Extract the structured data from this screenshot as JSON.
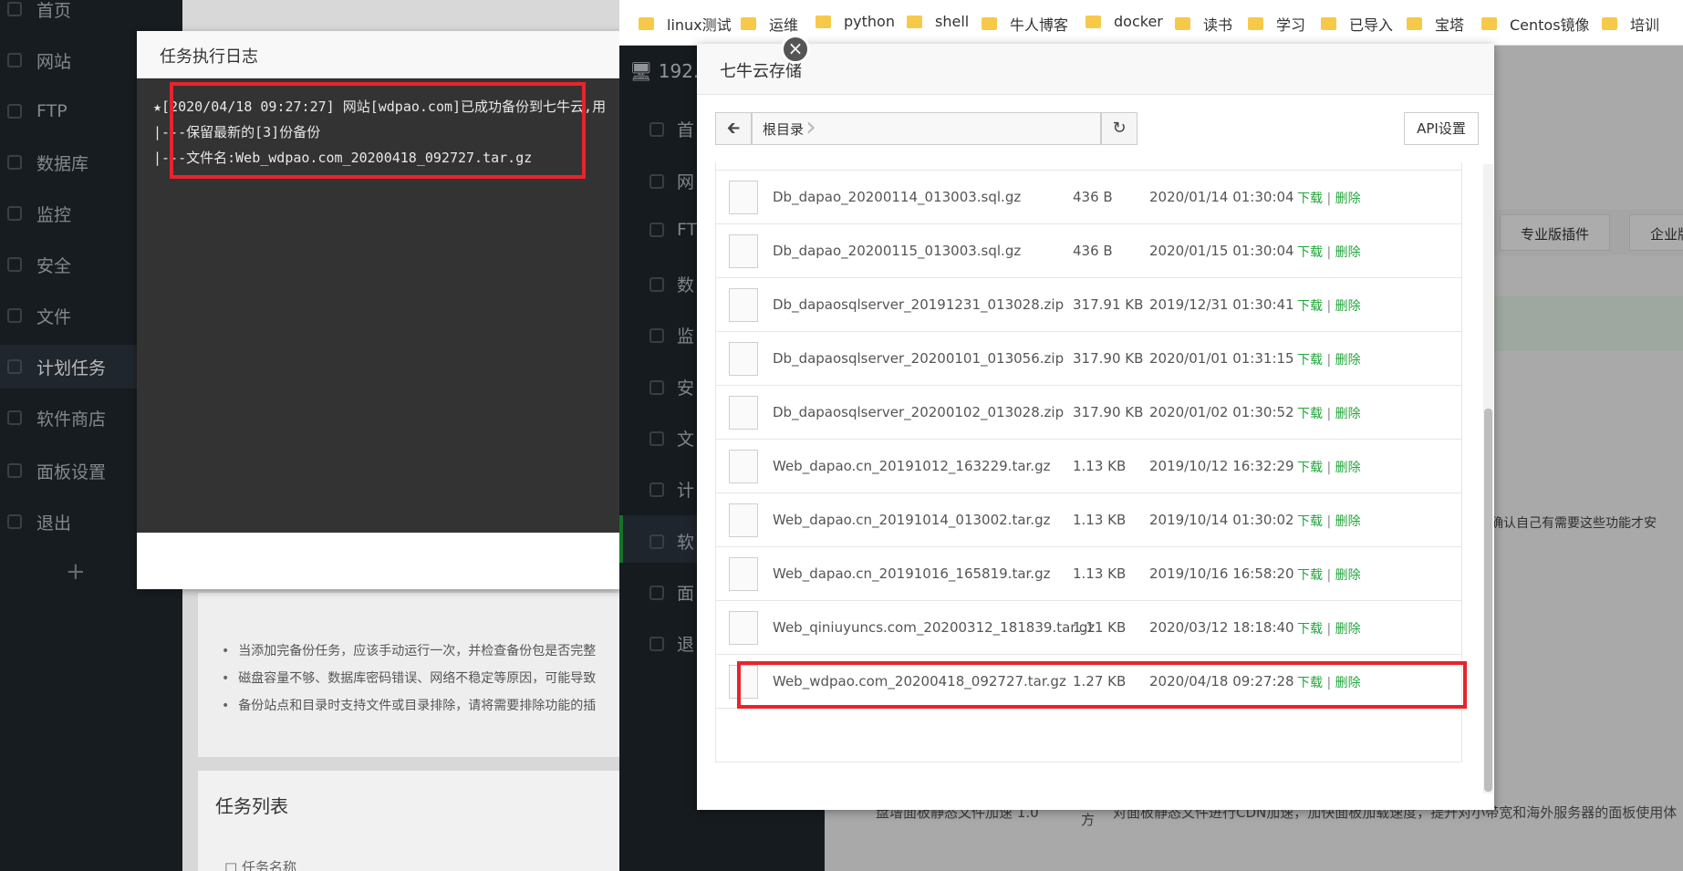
{
  "left_panel": {
    "nav": [
      {
        "label": "首页",
        "icon": "home-icon"
      },
      {
        "label": "网站",
        "icon": "globe-icon"
      },
      {
        "label": "FTP",
        "icon": "ftp-icon"
      },
      {
        "label": "数据库",
        "icon": "database-icon"
      },
      {
        "label": "监控",
        "icon": "monitor-icon"
      },
      {
        "label": "安全",
        "icon": "shield-icon"
      },
      {
        "label": "文件",
        "icon": "folder-icon"
      },
      {
        "label": "计划任务",
        "icon": "calendar-icon",
        "active": true
      },
      {
        "label": "软件商店",
        "icon": "grid-icon"
      },
      {
        "label": "面板设置",
        "icon": "gear-icon"
      },
      {
        "label": "退出",
        "icon": "logout-icon"
      }
    ],
    "plus": "+",
    "tips": [
      "当添加完备份任务，应该手动运行一次，并检查备份包是否完整",
      "磁盘容量不够、数据库密码错误、网络不稳定等原因，可能导致",
      "备份站点和目录时支持文件或目录排除，请将需要排除功能的插"
    ],
    "task_list_title": "任务列表",
    "task_list_header": "任务名称"
  },
  "log_dialog": {
    "title": "任务执行日志",
    "lines": [
      "★[2020/04/18 09:27:27] 网站[wdpao.com]已成功备份到七牛云,用",
      "|---保留最新的[3]份备份",
      "|---文件名:Web_wdpao.com_20200418_092727.tar.gz"
    ]
  },
  "bookmarks": [
    "linux测试",
    "运维",
    "python",
    "shell",
    "牛人博客",
    "docker",
    "读书",
    "学习",
    "已导入",
    "宝塔",
    "Centos镜像",
    "培训"
  ],
  "right_panel": {
    "header": "192.",
    "nav": [
      "首",
      "网",
      "FT",
      "数",
      "监",
      "安",
      "文",
      "计",
      "软",
      "面",
      "退"
    ],
    "buttons": [
      "专业版插件",
      "企业版"
    ],
    "note": "。确认自己有需要这些功能才安",
    "plugin_version": "盘增面板静态文件加速 1.0",
    "plugin_desc": "对面板静态文件进行CDN加速，加快面板加载速度，提升对小带宽和海外服务器的面板使用体",
    "fang": "方"
  },
  "qiniu_dialog": {
    "title": "七牛云存储",
    "close": "×",
    "root_label": "根目录",
    "api_label": "API设置",
    "download_label": "下载",
    "delete_label": "删除",
    "files": [
      {
        "name": "Db_dapao_20200114_013003.sql.gz",
        "size": "436 B",
        "time": "2020/01/14 01:30:04"
      },
      {
        "name": "Db_dapao_20200115_013003.sql.gz",
        "size": "436 B",
        "time": "2020/01/15 01:30:04"
      },
      {
        "name": "Db_dapaosqlserver_20191231_013028.zip",
        "size": "317.91 KB",
        "time": "2019/12/31 01:30:41"
      },
      {
        "name": "Db_dapaosqlserver_20200101_013056.zip",
        "size": "317.90 KB",
        "time": "2020/01/01 01:31:15"
      },
      {
        "name": "Db_dapaosqlserver_20200102_013028.zip",
        "size": "317.90 KB",
        "time": "2020/01/02 01:30:52"
      },
      {
        "name": "Web_dapao.cn_20191012_163229.tar.gz",
        "size": "1.13 KB",
        "time": "2019/10/12 16:32:29"
      },
      {
        "name": "Web_dapao.cn_20191014_013002.tar.gz",
        "size": "1.13 KB",
        "time": "2019/10/14 01:30:02"
      },
      {
        "name": "Web_dapao.cn_20191016_165819.tar.gz",
        "size": "1.13 KB",
        "time": "2019/10/16 16:58:20"
      },
      {
        "name": "Web_qiniuyuncs.com_20200312_181839.tar.gz",
        "size": "1.11 KB",
        "time": "2020/03/12 18:18:40"
      },
      {
        "name": "Web_wdpao.com_20200418_092727.tar.gz",
        "size": "1.27 KB",
        "time": "2020/04/18 09:27:28"
      }
    ]
  },
  "colors": {
    "sidebar": "#20272e",
    "accent_green": "#20a53a",
    "highlight_red": "#e8232c",
    "log_bg": "#333333"
  }
}
